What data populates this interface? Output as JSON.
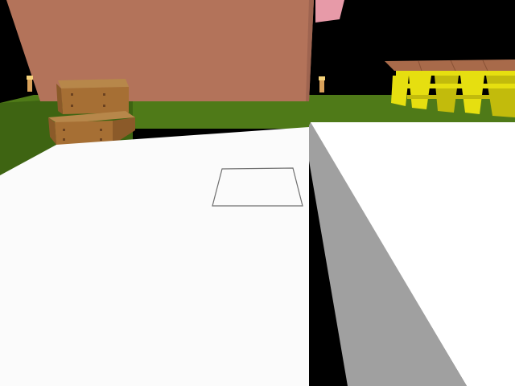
{
  "scene": {
    "title": "",
    "view": "first-person",
    "time_of_day": "night",
    "objects": [
      "terracotta-wall",
      "pink-block",
      "wooden-chest",
      "wooden-chest",
      "yellow-table",
      "torch",
      "torch",
      "white-floor",
      "white-block-ledge",
      "block-selection-outline"
    ]
  },
  "colors": {
    "sky": "#000000",
    "grass": "#4f7a18",
    "grass_dark": "#3e6412",
    "wall": "#b3735a",
    "wall_shade": "#9e6450",
    "pink_block": "#e79aa8",
    "floor": "#fbfbfb",
    "ledge_top": "#ffffff",
    "ledge_side": "#a0a0a0",
    "chest_top": "#b7874a",
    "chest_front": "#a66f34",
    "chest_side": "#8b5a29",
    "table_top": "#a86a4a",
    "table_legs": "#e6df10",
    "table_legs_dark": "#c2bb0c",
    "torch": "#d9a15a",
    "selection": "#6f6f6f"
  }
}
